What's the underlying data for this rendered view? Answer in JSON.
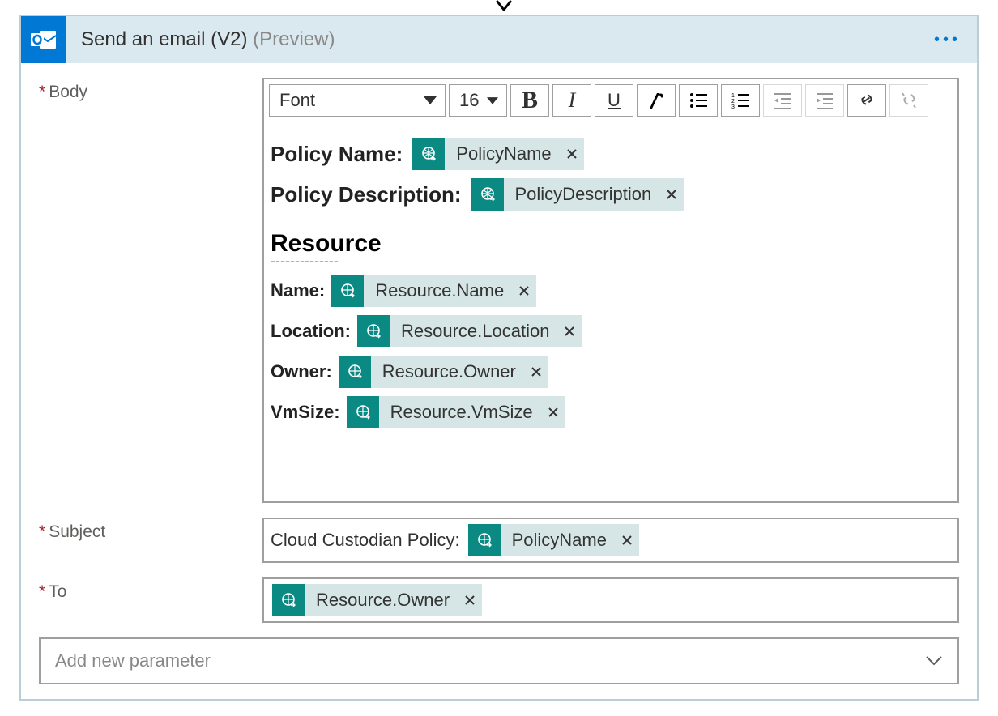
{
  "card": {
    "title": "Send an email (V2)",
    "preview": "Preview"
  },
  "toolbar": {
    "font": "Font",
    "size": "16",
    "bold": "B",
    "italic": "I",
    "underline": "U"
  },
  "fields": {
    "body": {
      "label": "Body"
    },
    "subject": {
      "label": "Subject",
      "prefix": "Cloud Custodian Policy:",
      "token": "PolicyName"
    },
    "to": {
      "label": "To",
      "token": "Resource.Owner"
    },
    "add_param": "Add new parameter"
  },
  "body": {
    "resource_heading": "Resource",
    "dashes": "--------------",
    "lines": [
      {
        "label": "Policy Name:",
        "token": "PolicyName"
      },
      {
        "label": "Policy Description:",
        "token": "PolicyDescription"
      },
      {
        "label": "Name:",
        "token": "Resource.Name"
      },
      {
        "label": "Location:",
        "token": "Resource.Location"
      },
      {
        "label": "Owner:",
        "token": "Resource.Owner"
      },
      {
        "label": "VmSize:",
        "token": "Resource.VmSize"
      }
    ]
  },
  "colors": {
    "header_bg": "#DAE9EF",
    "outlook_blue": "#0078D4",
    "token_teal": "#0B8A84",
    "token_light": "#D6E6E6",
    "border_gray": "#A19F9D",
    "required_red": "#A4262C"
  }
}
